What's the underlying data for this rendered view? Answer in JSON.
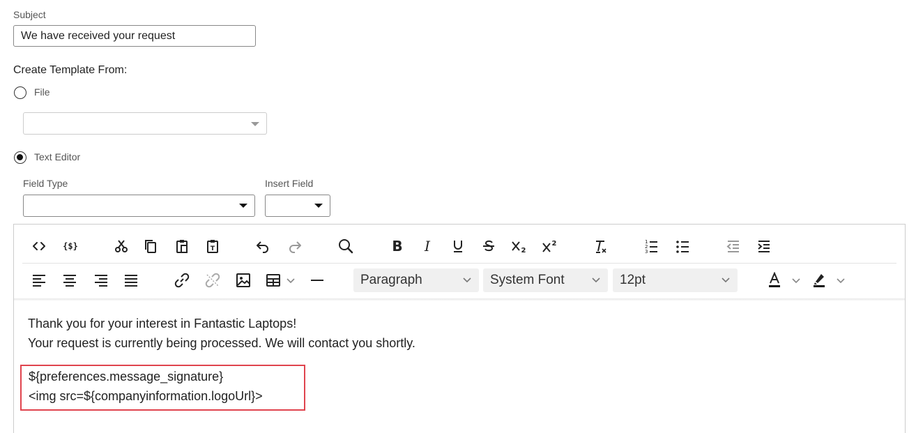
{
  "subject": {
    "label": "Subject",
    "value": "We have received your request"
  },
  "create_from": {
    "label": "Create Template From:"
  },
  "file_option": {
    "label": "File",
    "checked": false,
    "select_value": ""
  },
  "text_editor_option": {
    "label": "Text Editor",
    "checked": true
  },
  "field_type": {
    "label": "Field Type",
    "value": ""
  },
  "insert_field": {
    "label": "Insert Field",
    "value": ""
  },
  "toolbar": {
    "row1_icons": [
      "source-code-icon",
      "template-variable-icon",
      "cut-icon",
      "copy-icon",
      "paste-icon",
      "paste-as-text-icon",
      "undo-icon",
      "redo-icon",
      "find-replace-icon",
      "bold-icon",
      "italic-icon",
      "underline-icon",
      "strikethrough-icon",
      "subscript-icon",
      "superscript-icon",
      "clear-formatting-icon",
      "numbered-list-icon",
      "bullet-list-icon",
      "outdent-icon",
      "indent-icon"
    ],
    "row2_icons": [
      "align-left-icon",
      "align-center-icon",
      "align-right-icon",
      "justify-icon",
      "link-icon",
      "unlink-icon",
      "image-icon",
      "table-icon",
      "horizontal-rule-icon",
      "text-color-icon",
      "highlight-color-icon"
    ],
    "block_format": "Paragraph",
    "font_family": "System Font",
    "font_size": "12pt"
  },
  "content": {
    "line1": "Thank you for your interest in Fantastic Laptops!",
    "line2": "Your request is currently being processed. We will contact you shortly.",
    "sig_line1": "${preferences.message_signature}",
    "sig_line2": "<img src=${companyinformation.logoUrl}>"
  },
  "colors": {
    "highlight_border": "#e0444e",
    "text_color_bar": "#111111"
  }
}
